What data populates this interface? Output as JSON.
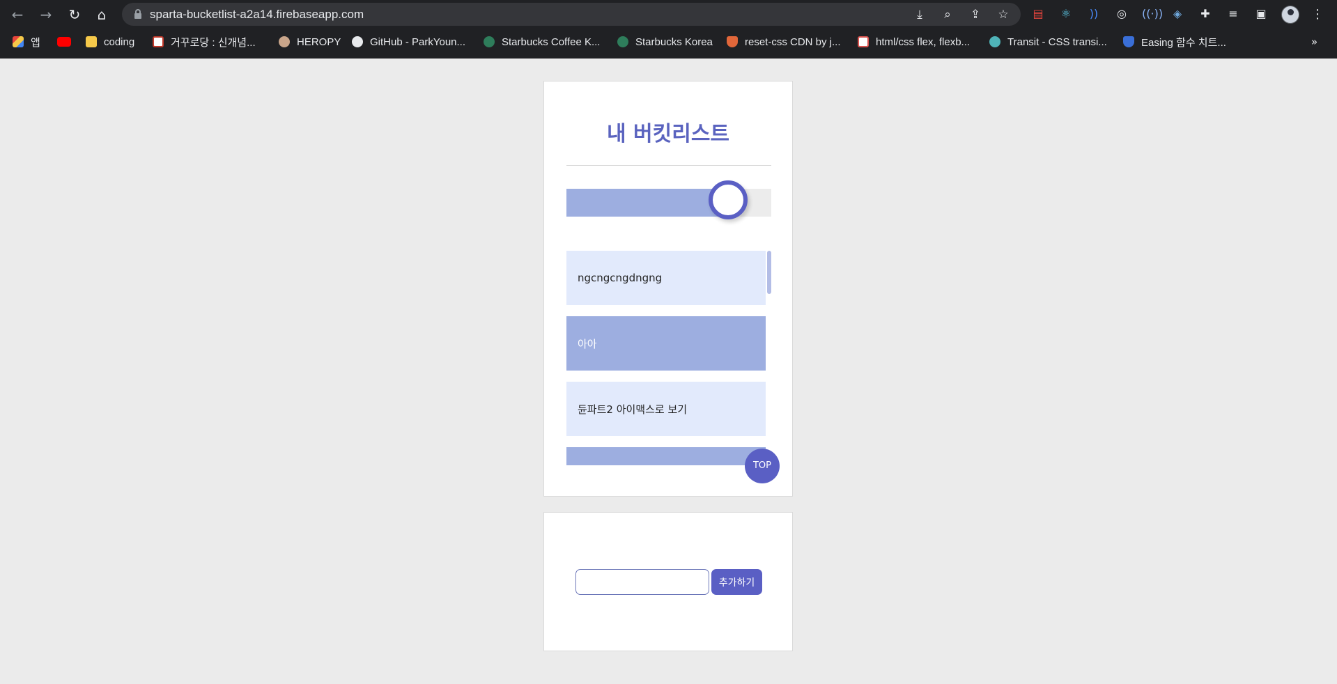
{
  "browser": {
    "url": "sparta-bucketlist-a2a14.firebaseapp.com",
    "extensions": [
      "extension-icon",
      "react-devtools-icon",
      "audio-icon",
      "target-icon",
      "broadcast-icon",
      "layers-icon",
      "puzzle-icon",
      "reading-list-icon",
      "side-panel-icon"
    ],
    "bookmarks": [
      {
        "label": "앱",
        "color": "#e8453c"
      },
      {
        "label": "",
        "color": "#ff0000"
      },
      {
        "label": "coding",
        "color": "#f6c94a"
      },
      {
        "label": "거꾸로당 : 신개념...",
        "color": "#c0392b"
      },
      {
        "label": "HEROPY",
        "color": "#c9a58a"
      },
      {
        "label": "GitHub - ParkYoun...",
        "color": "#e8eaed"
      },
      {
        "label": "Starbucks Coffee K...",
        "color": "#2e7d5b"
      },
      {
        "label": "Starbucks Korea",
        "color": "#2e7d5b"
      },
      {
        "label": "reset-css CDN by j...",
        "color": "#e2673a"
      },
      {
        "label": "html/css flex, flexb...",
        "color": "#d9534f"
      },
      {
        "label": "Transit - CSS transi...",
        "color": "#4fb3b8"
      },
      {
        "label": "Easing 함수 치트...",
        "color": "#3a6fd8"
      }
    ],
    "more": "»"
  },
  "app": {
    "title": "내 버킷리스트",
    "progress": 0.79,
    "items": [
      {
        "text": "ngcngcngdngng",
        "done": false
      },
      {
        "text": "아아",
        "done": true
      },
      {
        "text": "듄파트2 아이맥스로 보기",
        "done": false
      },
      {
        "text": "",
        "done": true
      }
    ],
    "top_label": "TOP",
    "add_label": "추가하기",
    "input_value": ""
  },
  "colors": {
    "accent": "#5a5fc4",
    "done_bg": "#9daee0",
    "todo_bg": "#e2eafc"
  }
}
